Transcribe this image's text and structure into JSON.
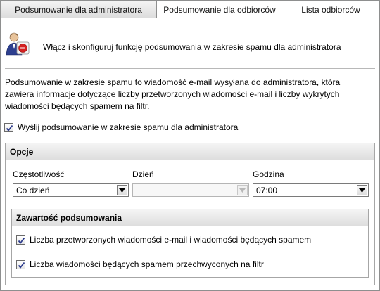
{
  "tabs": [
    {
      "label": "Podsumowanie dla administratora",
      "active": true
    },
    {
      "label": "Podsumowanie dla odbiorców",
      "active": false
    },
    {
      "label": "Lista odbiorców",
      "active": false
    }
  ],
  "header": {
    "icon": "admin-user-icon",
    "text": "Włącz i skonfiguruj funkcję podsumowania w zakresie spamu dla administratora"
  },
  "description": {
    "line1": "Podsumowanie w zakresie spamu to wiadomość e-mail wysyłana do administratora, która",
    "line2": "zawiera informacje dotyczące liczby przetworzonych wiadomości e-mail i liczby wykrytych",
    "line3": "wiadomości będących spamem na filtr."
  },
  "send_summary": {
    "label": "Wyślij podsumowanie w zakresie spamu dla administratora",
    "checked": true
  },
  "options": {
    "title": "Opcje",
    "frequency": {
      "label": "Częstotliwość",
      "value": "Co dzień"
    },
    "day": {
      "label": "Dzień",
      "value": "",
      "disabled": true
    },
    "hour": {
      "label": "Godzina",
      "value": "07:00"
    },
    "summary_content": {
      "title": "Zawartość podsumowania",
      "items": [
        {
          "label": "Liczba przetworzonych wiadomości e-mail i wiadomości będących spamem",
          "checked": true
        },
        {
          "label": "Liczba wiadomości będących spamem przechwyconych na filtr",
          "checked": true
        }
      ]
    }
  },
  "colors": {
    "border": "#8e8f8f",
    "check": "#2b3a8c"
  }
}
